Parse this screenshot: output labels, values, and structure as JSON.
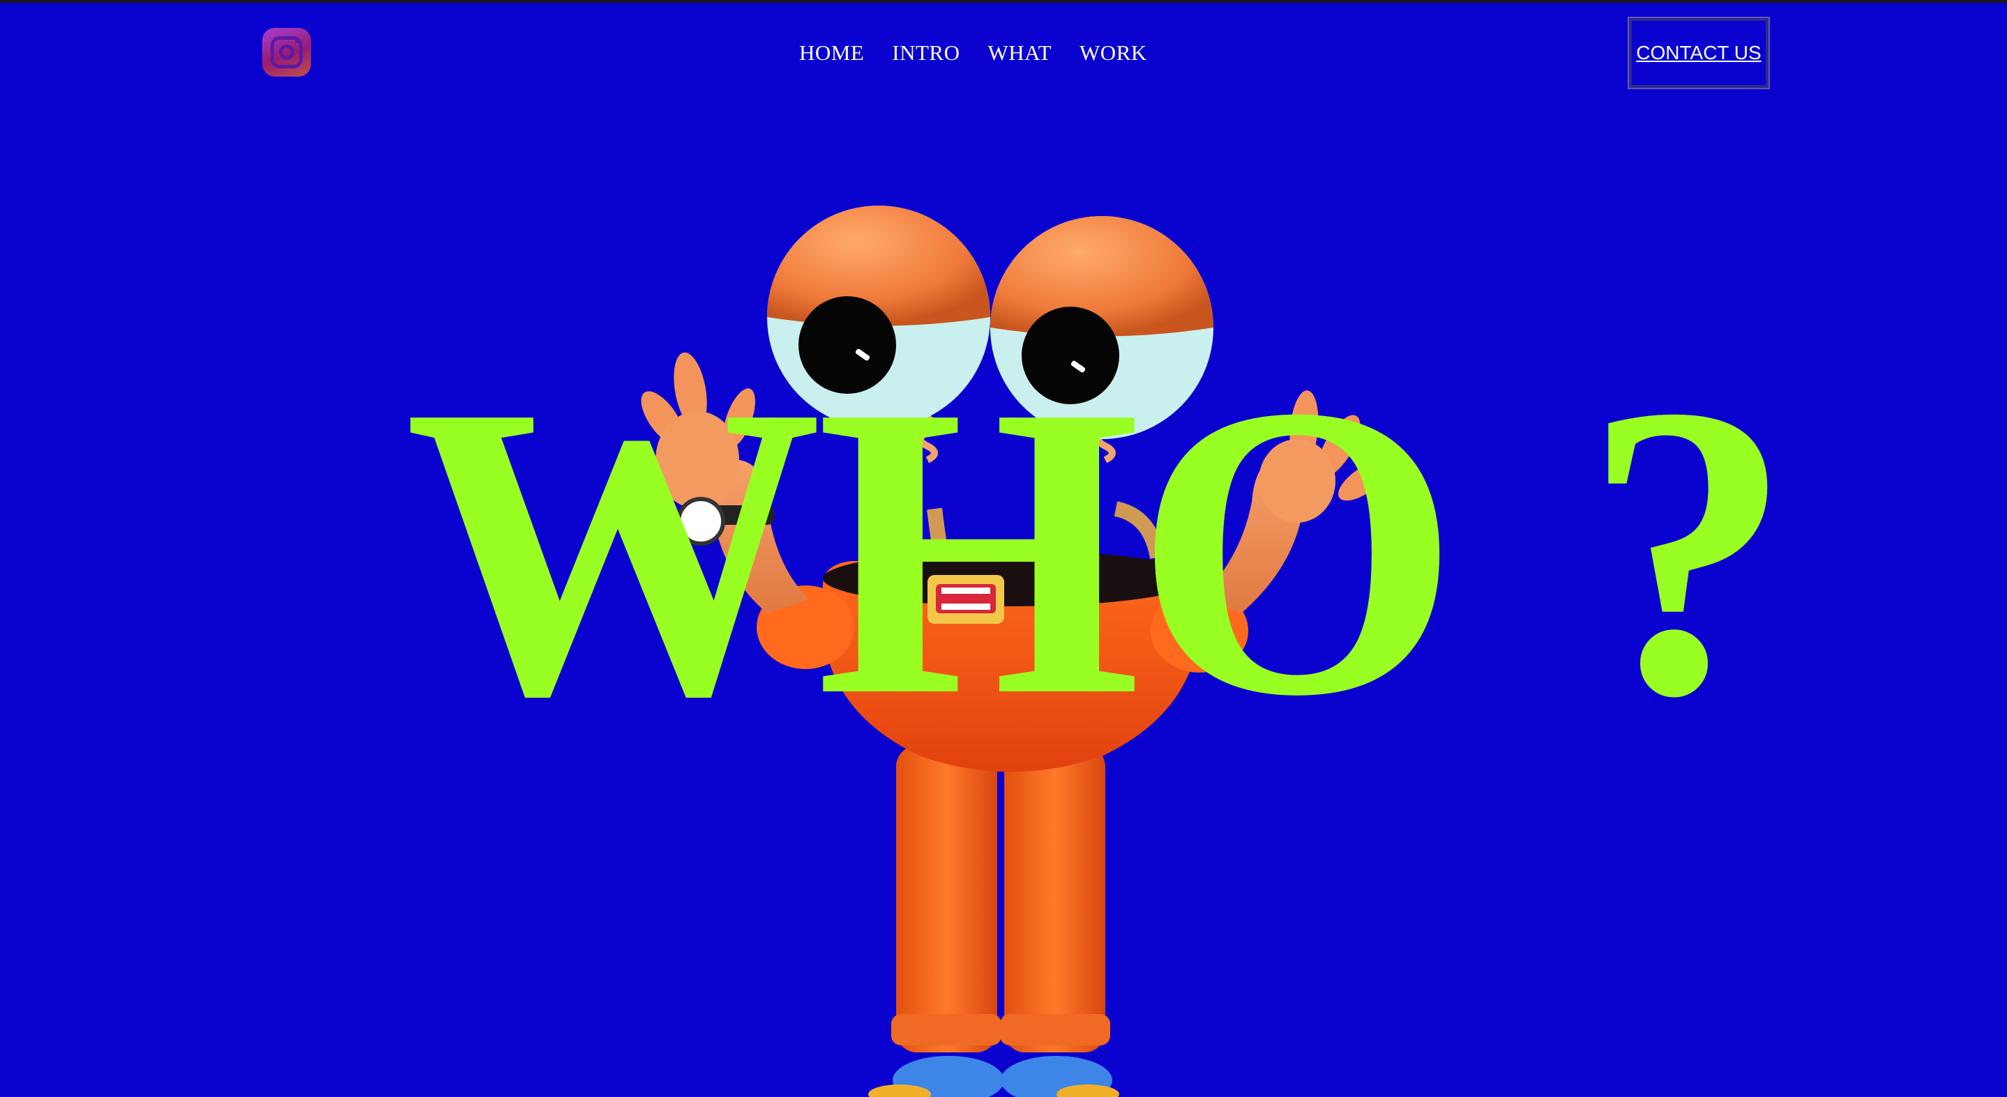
{
  "colors": {
    "background": "#0a02cf",
    "headline": "#99ff22",
    "nav_text": "#ffffff"
  },
  "header": {
    "social_icon": "instagram-icon",
    "nav": [
      {
        "label": "HOME"
      },
      {
        "label": "INTRO"
      },
      {
        "label": "WHAT"
      },
      {
        "label": "WORK"
      }
    ],
    "contact_label": "CONTACT US"
  },
  "hero": {
    "headline_word": "WHO",
    "headline_mark": "?"
  }
}
